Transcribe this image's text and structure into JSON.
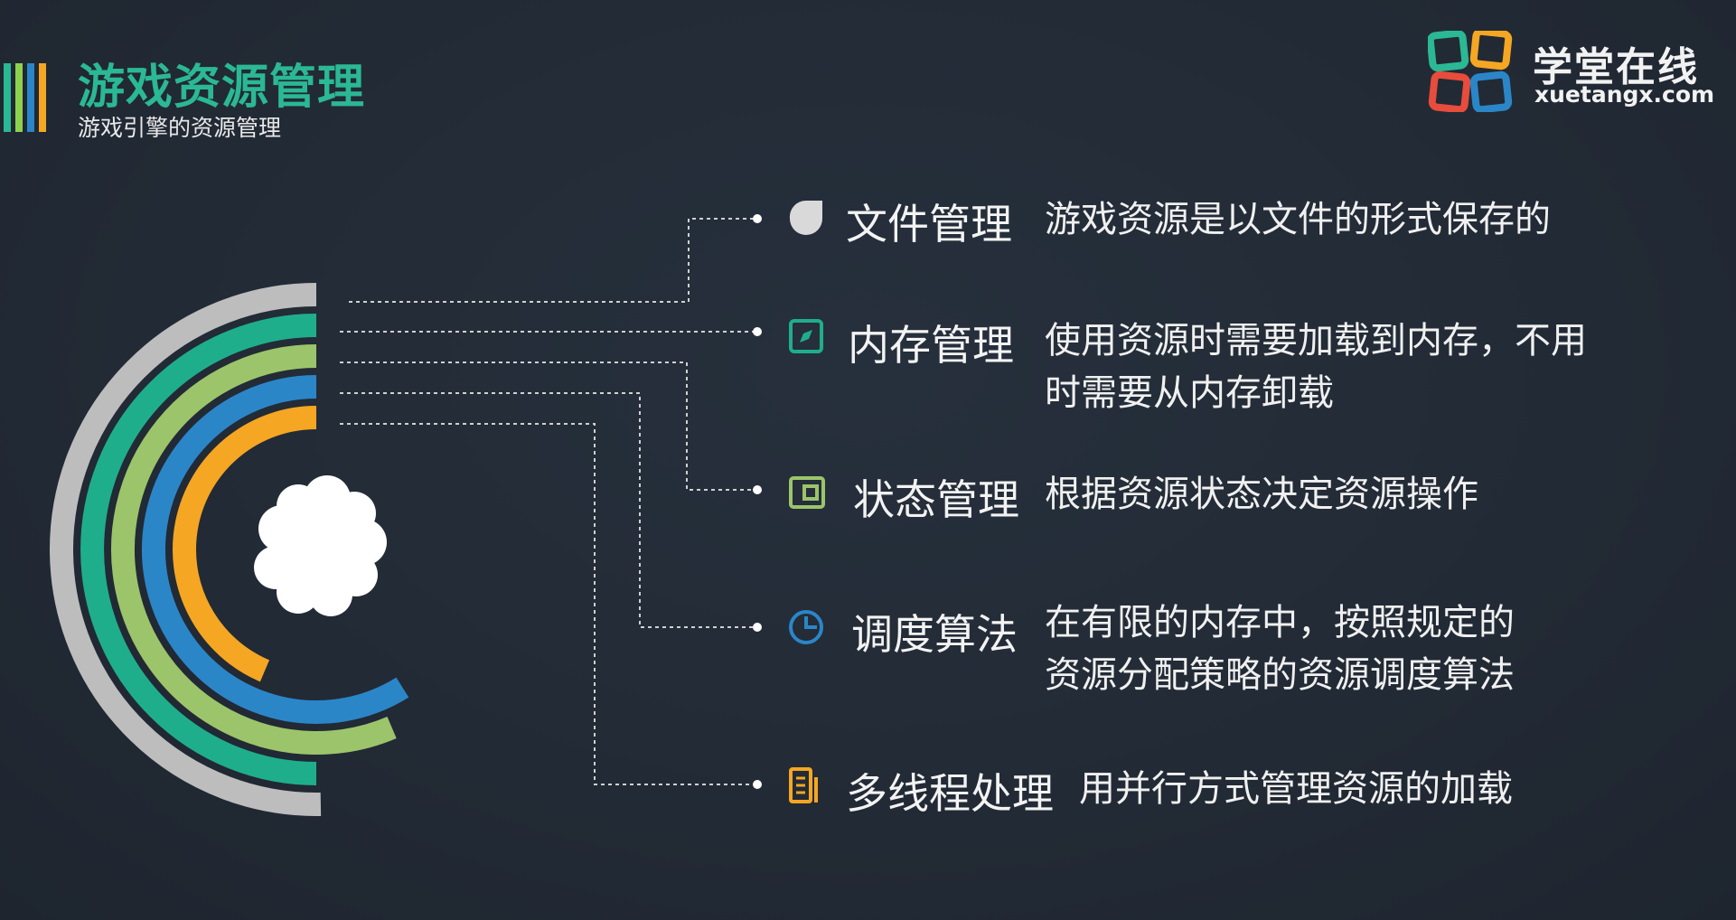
{
  "header": {
    "title": "游戏资源管理",
    "subtitle": "游戏引擎的资源管理",
    "bar_colors": [
      "#2bb894",
      "#8fd14f",
      "#2b86c8",
      "#f5a623"
    ]
  },
  "logo": {
    "name_cn": "学堂在线",
    "domain": "xuetangx.com",
    "colors": [
      "#2bb894",
      "#f5a623",
      "#e74c3c",
      "#2b86c8"
    ]
  },
  "rings": {
    "colors": [
      "#bdbdbd",
      "#1fae8c",
      "#9cc46a",
      "#2b86c8",
      "#f5a623"
    ]
  },
  "items": [
    {
      "icon": "leaf-icon",
      "color": "#d9d9d9",
      "name": "文件管理",
      "desc": [
        "游戏资源是以文件的形式保存的"
      ]
    },
    {
      "icon": "compass-icon",
      "color": "#1fae8c",
      "name": "内存管理",
      "desc": [
        "使用资源时需要加载到内存，不用",
        "时需要从内存卸载"
      ]
    },
    {
      "icon": "window-icon",
      "color": "#9cc46a",
      "name": "状态管理",
      "desc": [
        "根据资源状态决定资源操作"
      ]
    },
    {
      "icon": "clock-icon",
      "color": "#2b86c8",
      "name": "调度算法",
      "desc": [
        "在有限的内存中，按照规定的",
        "资源分配策略的资源调度算法"
      ]
    },
    {
      "icon": "document-icon",
      "color": "#f5a623",
      "name": "多线程处理",
      "desc": [
        "用并行方式管理资源的加载"
      ]
    }
  ]
}
